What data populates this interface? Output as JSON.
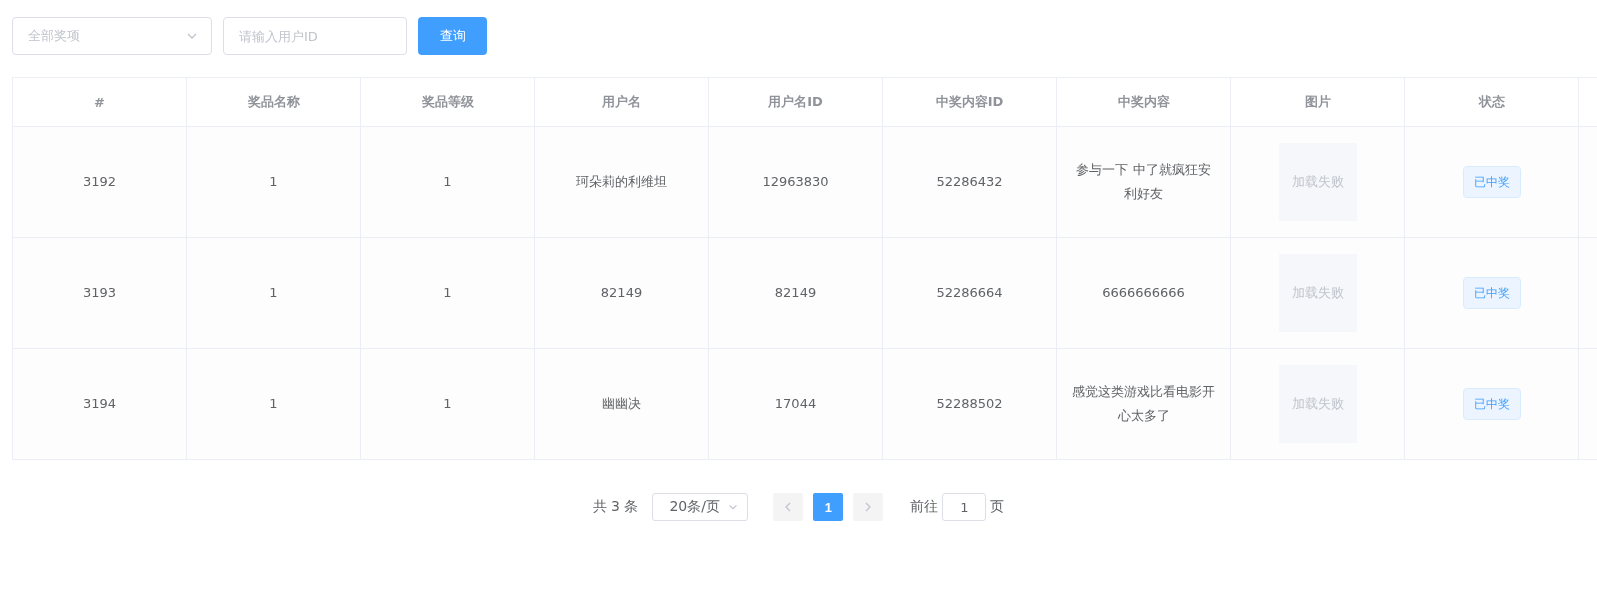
{
  "filters": {
    "prize_select": {
      "placeholder": "全部奖项"
    },
    "user_id": {
      "placeholder": "请输入用户ID"
    },
    "search_button": "查询"
  },
  "table": {
    "columns": [
      "#",
      "奖品名称",
      "奖品等级",
      "用户名",
      "用户名ID",
      "中奖内容ID",
      "中奖内容",
      "图片",
      "状态"
    ],
    "rows": [
      {
        "cells": [
          "3192",
          "1",
          "1",
          "珂朵莉的利维坦",
          "12963830",
          "52286432",
          "参与一下 中了就疯狂安利好友"
        ],
        "image": "加载失败",
        "status": "已中奖"
      },
      {
        "cells": [
          "3193",
          "1",
          "1",
          "82149",
          "82149",
          "52286664",
          "6666666666"
        ],
        "image": "加载失败",
        "status": "已中奖"
      },
      {
        "cells": [
          "3194",
          "1",
          "1",
          "幽幽决",
          "17044",
          "52288502",
          "感觉这类游戏比看电影开心太多了"
        ],
        "image": "加载失败",
        "status": "已中奖"
      }
    ]
  },
  "pagination": {
    "total": "共 3 条",
    "page_size": "20条/页",
    "pages": [
      {
        "label": "1",
        "selected": true
      }
    ],
    "goto_label": "前往",
    "goto_value": "1",
    "goto_suffix": "页"
  }
}
